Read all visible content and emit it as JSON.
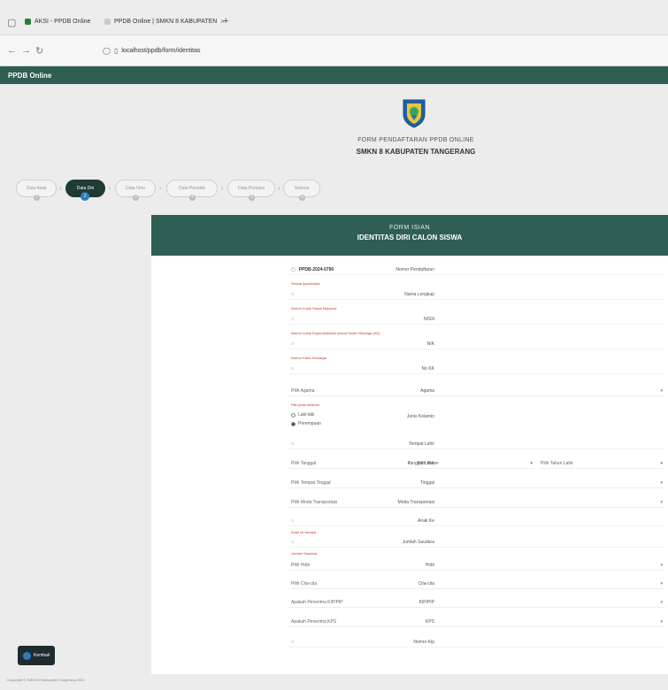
{
  "browser": {
    "tabs": [
      {
        "label": "AKSI - PPDB Online"
      },
      {
        "label": "PPDB Online | SMKN 8 KABUPATEN"
      }
    ],
    "url": "localhost/ppdb/form/identitas"
  },
  "app": {
    "title": "PPDB Online"
  },
  "hero": {
    "line1": "FORM PENDAFTARAN PPDB ONLINE",
    "line2": "SMKN 8 KABUPATEN TANGERANG"
  },
  "steps": [
    {
      "label": "Data Awal",
      "num": "1"
    },
    {
      "label": "Data Diri",
      "num": "2"
    },
    {
      "label": "Data Ortu",
      "num": "3"
    },
    {
      "label": "Data Periodik",
      "num": "4"
    },
    {
      "label": "Data Prestasi",
      "num": "5"
    },
    {
      "label": "Selesai",
      "num": "6"
    }
  ],
  "form": {
    "header_sub": "FORM ISIAN",
    "header_title": "IDENTITAS DIRI CALON SISWA",
    "nomor_label": "Nomor Pendaftaran",
    "nomor_value": "PPDB-2024-0790",
    "nama_label": "Nama Lengkap",
    "nama_hint": "Sesuai ijazah/akta",
    "nisn_label": "NISN",
    "nisn_hint": "Nomor Induk Siswa Nasional",
    "nik_label": "NIK",
    "nik_hint": "Nomor Induk Kependudukan sesuai Kartu Keluarga (KK)",
    "no_kk_label": "No KK",
    "no_kk_hint": "Nomor Kartu Keluarga",
    "agama_label": "Agama",
    "agama_value": "Pilih Agama",
    "jk_label": "Jenis Kelamin",
    "jk_hint": "Pilih jenis kelamin",
    "jk_opt1": "Laki-laki",
    "jk_opt2": "Perempuan",
    "tempat_lahir_label": "Tempat Lahir",
    "tgl_lahir_label": "Tanggal Lahir",
    "tgl_value": "Pilih Tanggal",
    "bln_value": "Pilih Bulan",
    "thn_value": "Pilih Tahun Lahir",
    "tinggal_label": "Tinggal",
    "tinggal_value": "Pilih Tempat Tinggal",
    "transport_label": "Moda Transportasi",
    "transport_value": "Pilih Moda Transportasi",
    "anak_label": "Anak Ke",
    "anak_hint": "Anak ke berapa",
    "saudara_label": "Jumlah Saudara",
    "saudara_hint": "Jumlah Saudara",
    "hobi_label": "Hobi",
    "hobi_value": "Pilih Hobi",
    "cita_label": "Cita-cita",
    "cita_value": "Pilih Cita-cita",
    "pip_label": "KIP/PIP",
    "pip_value": "Apakah Penerima KIP/PIP",
    "kps_label": "KPS",
    "kps_value": "Apakah Penerima KPS",
    "nomor_kip_label": "Nomor Kip"
  },
  "footer": {
    "back_label": "Kembali",
    "copyright": "Copyright © SMKN 8 Kabupaten Tangerang 2024"
  }
}
